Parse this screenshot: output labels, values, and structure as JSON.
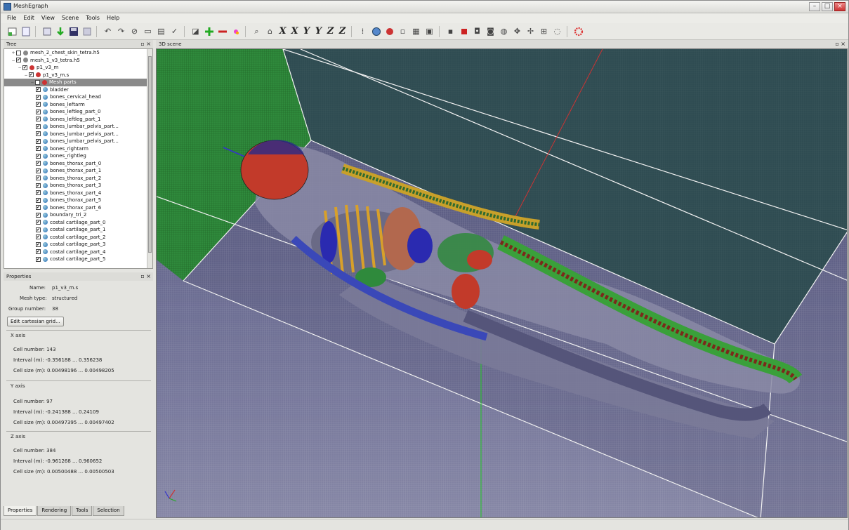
{
  "window": {
    "title": "MeshEgraph"
  },
  "menu": [
    "File",
    "Edit",
    "View",
    "Scene",
    "Tools",
    "Help"
  ],
  "toolbar": {
    "axis_buttons": [
      "X",
      "X",
      "Y",
      "Y",
      "Z",
      "Z"
    ]
  },
  "tree_panel": {
    "title": "Tree",
    "items": [
      {
        "label": "mesh_2_chest_skin_tetra.h5",
        "indent": 1,
        "checked": false,
        "icon": "mesh-icon"
      },
      {
        "label": "mesh_1_v3_tetra.h5",
        "indent": 1,
        "checked": true,
        "icon": "mesh-icon"
      },
      {
        "label": "p1_v3_m",
        "indent": 2,
        "checked": true,
        "icon": "group-icon"
      },
      {
        "label": "p1_v3_m.s",
        "indent": 3,
        "checked": true,
        "icon": "group-icon"
      },
      {
        "label": "Mesh parts",
        "indent": 4,
        "checked": true,
        "icon": "parts-icon",
        "selected": true
      },
      {
        "label": "bladder",
        "indent": 5,
        "checked": true
      },
      {
        "label": "bones_cervical_head",
        "indent": 5,
        "checked": true
      },
      {
        "label": "bones_leftarm",
        "indent": 5,
        "checked": true
      },
      {
        "label": "bones_leftleg_part_0",
        "indent": 5,
        "checked": true
      },
      {
        "label": "bones_leftleg_part_1",
        "indent": 5,
        "checked": true
      },
      {
        "label": "bones_lumbar_pelvis_part...",
        "indent": 5,
        "checked": true
      },
      {
        "label": "bones_lumbar_pelvis_part...",
        "indent": 5,
        "checked": true
      },
      {
        "label": "bones_lumbar_pelvis_part...",
        "indent": 5,
        "checked": true
      },
      {
        "label": "bones_rightarm",
        "indent": 5,
        "checked": true
      },
      {
        "label": "bones_rightleg",
        "indent": 5,
        "checked": true
      },
      {
        "label": "bones_thorax_part_0",
        "indent": 5,
        "checked": true
      },
      {
        "label": "bones_thorax_part_1",
        "indent": 5,
        "checked": true
      },
      {
        "label": "bones_thorax_part_2",
        "indent": 5,
        "checked": true
      },
      {
        "label": "bones_thorax_part_3",
        "indent": 5,
        "checked": true
      },
      {
        "label": "bones_thorax_part_4",
        "indent": 5,
        "checked": true
      },
      {
        "label": "bones_thorax_part_5",
        "indent": 5,
        "checked": true
      },
      {
        "label": "bones_thorax_part_6",
        "indent": 5,
        "checked": true
      },
      {
        "label": "boundary_tri_2",
        "indent": 5,
        "checked": true
      },
      {
        "label": "costal cartilage_part_0",
        "indent": 5,
        "checked": true
      },
      {
        "label": "costal cartilage_part_1",
        "indent": 5,
        "checked": true
      },
      {
        "label": "costal cartilage_part_2",
        "indent": 5,
        "checked": true
      },
      {
        "label": "costal cartilage_part_3",
        "indent": 5,
        "checked": true
      },
      {
        "label": "costal cartilage_part_4",
        "indent": 5,
        "checked": true
      },
      {
        "label": "costal cartilage_part_5",
        "indent": 5,
        "checked": true
      }
    ]
  },
  "properties_panel": {
    "title": "Properties",
    "name_label": "Name:",
    "name_value": "p1_v3_m.s",
    "mesh_type_label": "Mesh type:",
    "mesh_type_value": "structured",
    "group_number_label": "Group number:",
    "group_number_value": "38",
    "edit_button": "Edit cartesian grid...",
    "axes": [
      {
        "title": "X axis",
        "cell_number": "Cell number: 143",
        "interval": "Interval (m): -0.356188 ... 0.356238",
        "cell_size": "Cell size (m): 0.00498196 ... 0.00498205"
      },
      {
        "title": "Y axis",
        "cell_number": "Cell number: 97",
        "interval": "Interval (m): -0.241388 ... 0.24109",
        "cell_size": "Cell size (m): 0.00497395 ... 0.00497402"
      },
      {
        "title": "Z axis",
        "cell_number": "Cell number: 384",
        "interval": "Interval (m): -0.961268 ... 0.960652",
        "cell_size": "Cell size (m): 0.00500488 ... 0.00500503"
      }
    ]
  },
  "bottom_tabs": [
    "Properties",
    "Rendering",
    "Tools",
    "Selection"
  ],
  "scene_panel": {
    "title": "3D scene"
  }
}
